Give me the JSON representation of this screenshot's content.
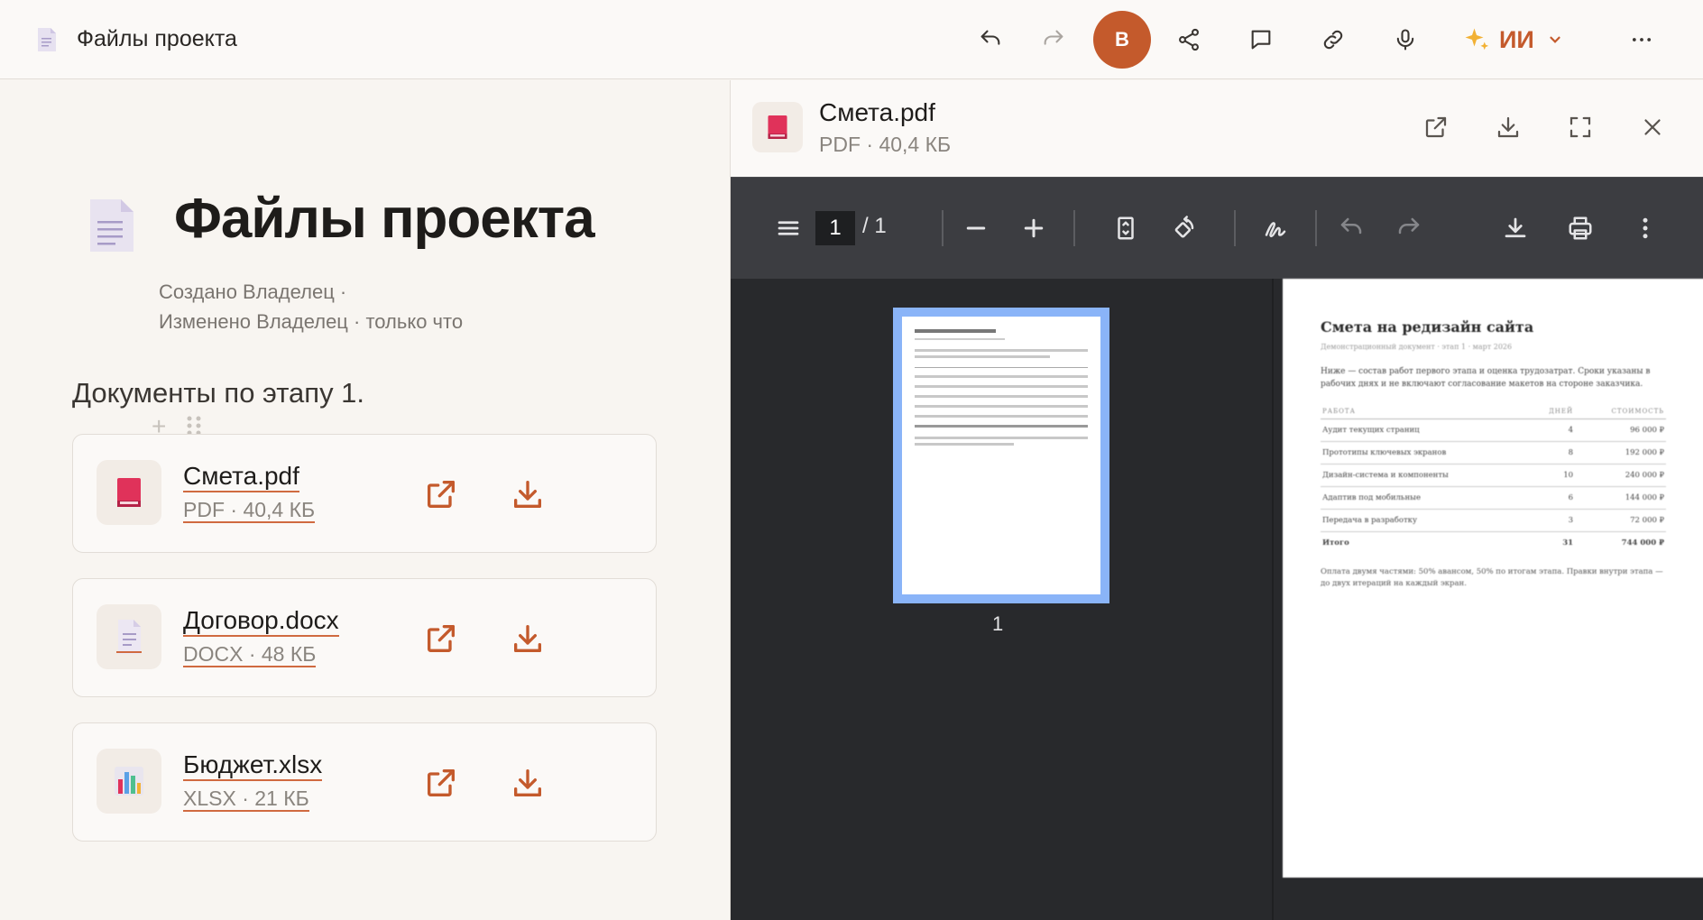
{
  "topbar": {
    "title": "Файлы проекта",
    "avatar_letter": "В",
    "avatar_color": "#c45a2c",
    "ai_label": "ИИ",
    "icons": [
      "undo-icon",
      "redo-icon",
      "share-icon",
      "comment-icon",
      "link-icon",
      "microphone-icon",
      "sparkle-icon",
      "chevron-down-icon",
      "more-icon"
    ]
  },
  "page": {
    "title": "Файлы проекта",
    "meta_created": "Создано Владелец  ·",
    "meta_modified": "Изменено Владелец · только что",
    "section_text": "Документы по этапу 1."
  },
  "files": [
    {
      "name": "Смета.pdf",
      "meta": "PDF · 40,4 КБ",
      "icon": "pdf-book-icon"
    },
    {
      "name": "Договор.docx",
      "meta": "DOCX · 48 КБ",
      "icon": "document-icon"
    },
    {
      "name": "Бюджет.xlsx",
      "meta": "XLSX · 21 КБ",
      "icon": "spreadsheet-chart-icon"
    }
  ],
  "preview": {
    "name": "Смета.pdf",
    "meta": "PDF · 40,4 КБ",
    "viewer": {
      "current_page": "1",
      "page_of": "/  1",
      "thumb_label": "1"
    },
    "pdf": {
      "title": "Смета на редизайн сайта",
      "subtitle": "Демонстрационный документ · этап 1 · март 2026",
      "intro": "Ниже — состав работ первого этапа и оценка трудозатрат. Сроки указаны в рабочих днях и не включают согласование макетов на стороне заказчика.",
      "col_work": "РАБОТА",
      "col_days": "ДНЕЙ",
      "col_cost": "СТОИМОСТЬ",
      "rows": [
        {
          "work": "Аудит текущих страниц",
          "days": "4",
          "cost": "96 000 ₽"
        },
        {
          "work": "Прототипы ключевых экранов",
          "days": "8",
          "cost": "192 000 ₽"
        },
        {
          "work": "Дизайн-система и компоненты",
          "days": "10",
          "cost": "240 000 ₽"
        },
        {
          "work": "Адаптив под мобильные",
          "days": "6",
          "cost": "144 000 ₽"
        },
        {
          "work": "Передача в разработку",
          "days": "3",
          "cost": "72 000 ₽"
        }
      ],
      "total": {
        "work": "Итого",
        "days": "31",
        "cost": "744 000 ₽"
      },
      "footer": "Оплата двумя частями: 50% авансом, 50% по итогам этапа. Правки внутри этапа — до двух итераций на каждый экран."
    }
  }
}
